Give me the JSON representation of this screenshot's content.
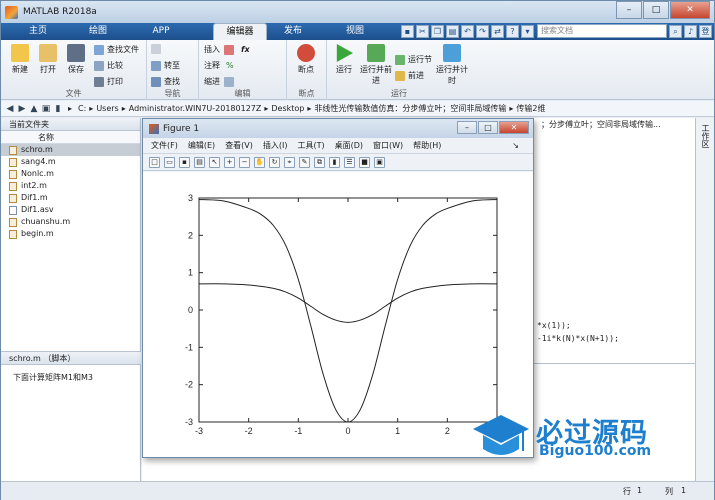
{
  "app": {
    "title": "MATLAB R2018a"
  },
  "tabs": [
    "主页",
    "绘图",
    "APP",
    "编辑器",
    "发布",
    "视图"
  ],
  "search": {
    "placeholder": "搜索文档"
  },
  "minimize_label": "登录",
  "ribbon": {
    "file_group": {
      "label": "文件",
      "new": "新建",
      "open": "打开",
      "save": "保存",
      "find_files": "查找文件",
      "compare": "比较",
      "print": "打印"
    },
    "nav_group": {
      "label": "导航",
      "goto": "转至",
      "find": "查找"
    },
    "edit_group": {
      "label": "编辑",
      "insert": "插入",
      "comment": "注释",
      "indent": "缩进"
    },
    "breakpoint_group": {
      "label": "断点",
      "breakpoints": "断点"
    },
    "run_group": {
      "label": "运行",
      "run": "运行",
      "run_advance": "运行并前进",
      "run_section": "运行节",
      "advance": "前进",
      "run_time": "运行并计时"
    }
  },
  "address": {
    "segments": [
      "C:",
      "Users",
      "Administrator.WIN7U-20180127Z",
      "Desktop",
      "非线性光传输数值仿真：分步傅立叶；空间非局域传输",
      "传输2维"
    ],
    "editor_tab_suffix": "；分步傅立叶；空间非局域传输..."
  },
  "file_panel": {
    "title": "当前文件夹",
    "column": "名称",
    "files": [
      {
        "name": "schro.m",
        "type": "m",
        "selected": true
      },
      {
        "name": "sang4.m",
        "type": "m"
      },
      {
        "name": "Nonlc.m",
        "type": "m"
      },
      {
        "name": "int2.m",
        "type": "m"
      },
      {
        "name": "Dif1.m",
        "type": "m"
      },
      {
        "name": "Dif1.asv",
        "type": "asv"
      },
      {
        "name": "chuanshu.m",
        "type": "m"
      },
      {
        "name": "begin.m",
        "type": "m"
      }
    ]
  },
  "details": {
    "title": "schro.m （脚本）",
    "text": "下面计算矩阵M1和M3"
  },
  "right_strip": {
    "label": "工作区"
  },
  "code_lines": [
    "*x(1));",
    "-1i*k(N)*x(N+1));"
  ],
  "status": {
    "row_label": "行",
    "row_value": "1",
    "col_label": "列",
    "col_value": "1"
  },
  "figure": {
    "title": "Figure 1",
    "menu": [
      "文件(F)",
      "编辑(E)",
      "查看(V)",
      "插入(I)",
      "工具(T)",
      "桌面(D)",
      "窗口(W)",
      "帮助(H)"
    ]
  },
  "chart_data": {
    "type": "line",
    "xlim": [
      -3,
      3
    ],
    "ylim": [
      -3,
      3
    ],
    "xticks": [
      -3,
      -2,
      -1,
      0,
      1,
      2,
      3
    ],
    "yticks": [
      -3,
      -2,
      -1,
      0,
      1,
      2,
      3
    ],
    "title": "",
    "xlabel": "",
    "ylabel": "",
    "series": [
      {
        "x": [
          -3,
          -2.5,
          -2,
          -1.75,
          -1.5,
          -1.25,
          -1,
          -0.75,
          -0.5,
          -0.25,
          0,
          0.25,
          0.5,
          0.75,
          1,
          1.25,
          1.5,
          1.75,
          2,
          2.5,
          3
        ],
        "y": [
          2.96,
          2.92,
          2.72,
          2.56,
          2.26,
          1.72,
          0.82,
          -0.42,
          -1.72,
          -2.66,
          -3.0,
          -2.66,
          -1.72,
          -0.42,
          0.82,
          1.72,
          2.26,
          2.56,
          2.72,
          2.92,
          2.96
        ]
      },
      {
        "x": [
          -3,
          -2.5,
          -2,
          -1.5,
          -1.25,
          -1,
          -0.75,
          -0.5,
          -0.25,
          0,
          0.25,
          0.5,
          0.75,
          1,
          1.25,
          1.5,
          2,
          2.5,
          3
        ],
        "y": [
          0.7,
          0.7,
          0.67,
          0.58,
          0.48,
          0.32,
          0.1,
          -0.12,
          -0.27,
          -0.33,
          -0.27,
          -0.12,
          0.1,
          0.32,
          0.48,
          0.58,
          0.67,
          0.7,
          0.7
        ]
      }
    ]
  },
  "watermark": {
    "title": "必过源码",
    "url": "Biguo100.com"
  }
}
